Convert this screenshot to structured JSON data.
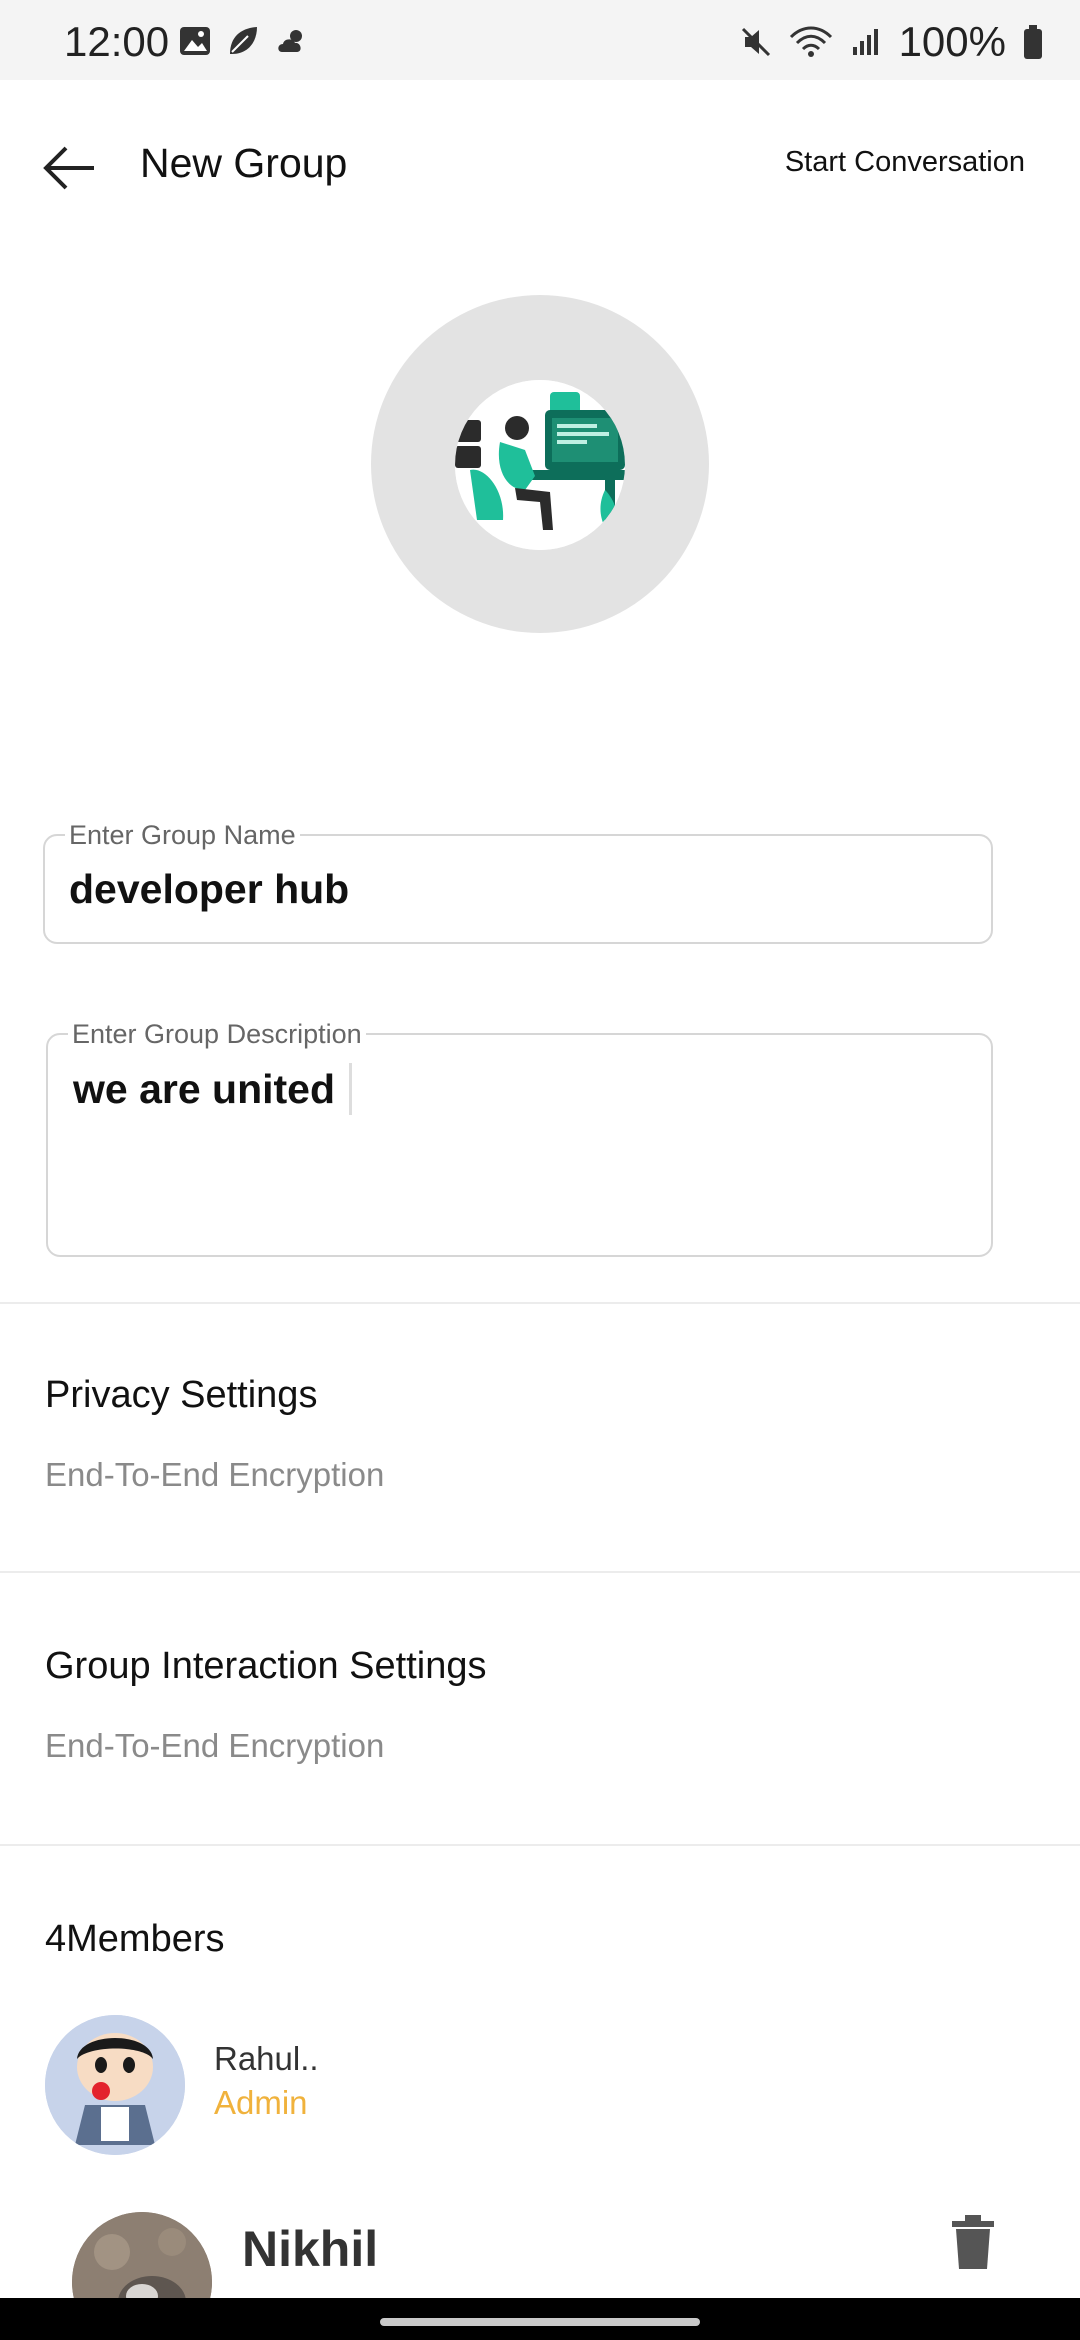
{
  "status_bar": {
    "time": "12:00",
    "battery": "100%",
    "icons": [
      "image-icon",
      "leaf-icon",
      "weather-icon",
      "mute-icon",
      "wifi-icon",
      "signal-icon",
      "battery-icon"
    ]
  },
  "app_bar": {
    "title": "New Group",
    "action": "Start Conversation",
    "back_icon": "back-arrow-icon"
  },
  "form": {
    "name_label": "Enter Group Name",
    "name_value": "developer hub",
    "description_label": "Enter Group Description",
    "description_value": "we are united"
  },
  "privacy": {
    "title": "Privacy Settings",
    "subtitle": "End-To-End Encryption"
  },
  "interaction": {
    "title": "Group Interaction Settings",
    "subtitle": "End-To-End Encryption"
  },
  "members": {
    "heading": "4Members",
    "list": [
      {
        "name": "Rahul..",
        "role": "Admin"
      },
      {
        "name": "Nikhil",
        "role": ""
      }
    ]
  },
  "colors": {
    "accent_role": "#f0b23c",
    "illustration_teal": "#1fbf9a"
  }
}
